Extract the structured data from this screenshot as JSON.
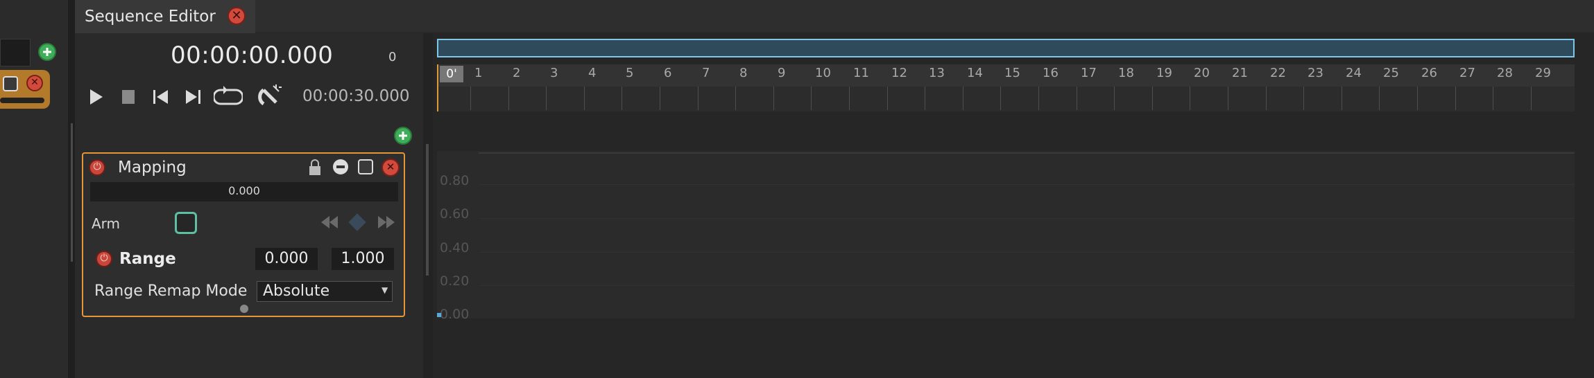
{
  "tab": {
    "title": "Sequence Editor"
  },
  "transport": {
    "current_time": "00:00:00.000",
    "frame": "0",
    "total_time": "00:00:30.000"
  },
  "ruler": {
    "start_label": "0'",
    "ticks": [
      "1",
      "2",
      "3",
      "4",
      "5",
      "6",
      "7",
      "8",
      "9",
      "10",
      "11",
      "12",
      "13",
      "14",
      "15",
      "16",
      "17",
      "18",
      "19",
      "20",
      "21",
      "22",
      "23",
      "24",
      "25",
      "26",
      "27",
      "28",
      "29"
    ]
  },
  "mapping": {
    "title": "Mapping",
    "value": "0.000",
    "arm_label": "Arm",
    "range_label": "Range",
    "range_min": "0.000",
    "range_max": "1.000",
    "remap_label": "Range Remap Mode",
    "remap_value": "Absolute"
  },
  "graph": {
    "y_labels": [
      "0.80",
      "0.60",
      "0.40",
      "0.20",
      "0.00"
    ]
  },
  "colors": {
    "accent_orange": "#e5963a",
    "range_blue": "#7fc7e8",
    "add_green": "#3fae59",
    "close_red": "#d24a3c",
    "arm_teal": "#5fbfa3"
  }
}
